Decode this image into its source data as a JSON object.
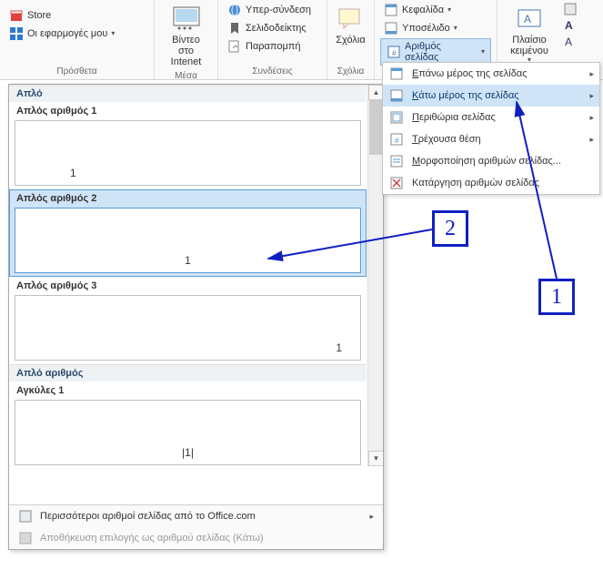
{
  "ribbon": {
    "addins": {
      "store": "Store",
      "myapps": "Οι εφαρμογές μου",
      "label": "Πρόσθετα"
    },
    "media": {
      "video": "Βίντεο στο Intenet",
      "label": "Μέσα"
    },
    "links": {
      "hyperlink": "Υπερ-σύνδεση",
      "bookmark": "Σελιδοδείκτης",
      "crossref": "Παραπομπή",
      "label": "Συνδέσεις"
    },
    "comments": {
      "comment": "Σχόλια",
      "label": "Σχόλια"
    },
    "headerfooter": {
      "header": "Κεφαλίδα",
      "footer": "Υποσέλιδο",
      "pagenum": "Αριθμός σελίδας"
    },
    "text": {
      "frame": "Πλαίσιο κειμένου"
    }
  },
  "menu": {
    "top": "Επάνω μέρος της σελίδας",
    "bottom": "Κάτω μέρος της σελίδας",
    "margins": "Περιθώρια σελίδας",
    "current": "Τρέχουσα θέση",
    "format": "Μορφοποίηση αριθμών σελίδας...",
    "remove": "Κατάργηση αριθμών σελίδας"
  },
  "gallery": {
    "cat1": "Απλό",
    "item1": "Απλός αριθμός 1",
    "item2": "Απλός αριθμός 2",
    "item3": "Απλός αριθμός 3",
    "cat2": "Απλό αριθμός",
    "item4": "Αγκύλες 1",
    "pg_left": "1",
    "pg_center": "1",
    "pg_right": "1",
    "pg_brackets": "|1|",
    "footer_more": "Περισσότεροι αριθμοί σελίδας από το Office.com",
    "footer_save": "Αποθήκευση επιλογής ως αριθμού σελίδας (Κάτω)"
  },
  "callout": {
    "n1": "1",
    "n2": "2"
  }
}
